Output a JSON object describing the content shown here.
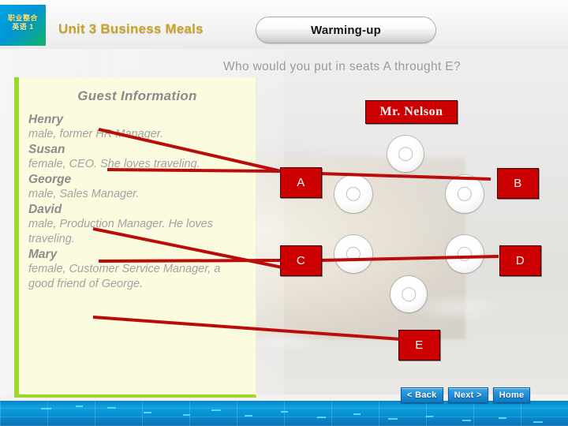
{
  "header": {
    "logo_line1": "职业整合",
    "logo_line2": "英语 1",
    "unit_title": "Unit 3 Business Meals",
    "badge_label": "Warming-up"
  },
  "question": "Who would you put in seats A throught E?",
  "panel": {
    "title": "Guest Information",
    "guests": [
      {
        "name": "Henry",
        "desc": "male, former HR Manager."
      },
      {
        "name": "Susan",
        "desc": "female, CEO. She loves traveling."
      },
      {
        "name": "George",
        "desc": "male, Sales Manager."
      },
      {
        "name": "David",
        "desc": "male, Production Manager. He loves traveling."
      },
      {
        "name": "Mary",
        "desc": "female, Customer Service Manager, a good friend of George."
      }
    ]
  },
  "diagram": {
    "host_label": "Mr. Nelson",
    "seats": [
      {
        "id": "A",
        "label": "A"
      },
      {
        "id": "B",
        "label": "B"
      },
      {
        "id": "C",
        "label": "C"
      },
      {
        "id": "D",
        "label": "D"
      },
      {
        "id": "E",
        "label": "E"
      }
    ],
    "accent_color": "#cc0000",
    "plate_count": 5
  },
  "nav": {
    "back_label": "< Back",
    "next_label": "Next >",
    "home_label": "Home"
  }
}
